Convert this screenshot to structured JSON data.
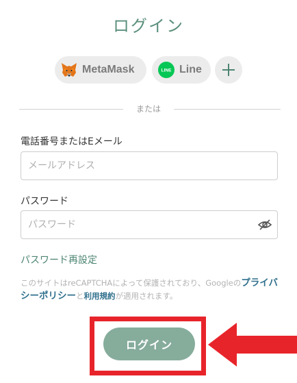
{
  "page": {
    "title": "ログイン"
  },
  "social": {
    "metamask_label": "MetaMask",
    "line_label": "Line",
    "line_icon_text": "LINE",
    "more_icon": "plus-icon"
  },
  "divider": {
    "text": "または"
  },
  "form": {
    "identifier_label": "電話番号またはEメール",
    "identifier_placeholder": "メールアドレス",
    "password_label": "パスワード",
    "password_placeholder": "パスワード",
    "password_toggle_icon": "eye-slash-icon",
    "reset_link": "パスワード再設定"
  },
  "notice": {
    "part1": "このサイトはreCAPTCHAによって保護されており、Googleの",
    "privacy_link": "プライバシーポリシー",
    "part2": "と",
    "terms_link": "利用規約",
    "part3": "が適用されます。"
  },
  "submit": {
    "label": "ログイン"
  },
  "colors": {
    "accent": "#5a8f7b",
    "button": "#86ac9c",
    "link": "#2f6f8c",
    "highlight": "#e8242b",
    "line_green": "#06c755"
  }
}
